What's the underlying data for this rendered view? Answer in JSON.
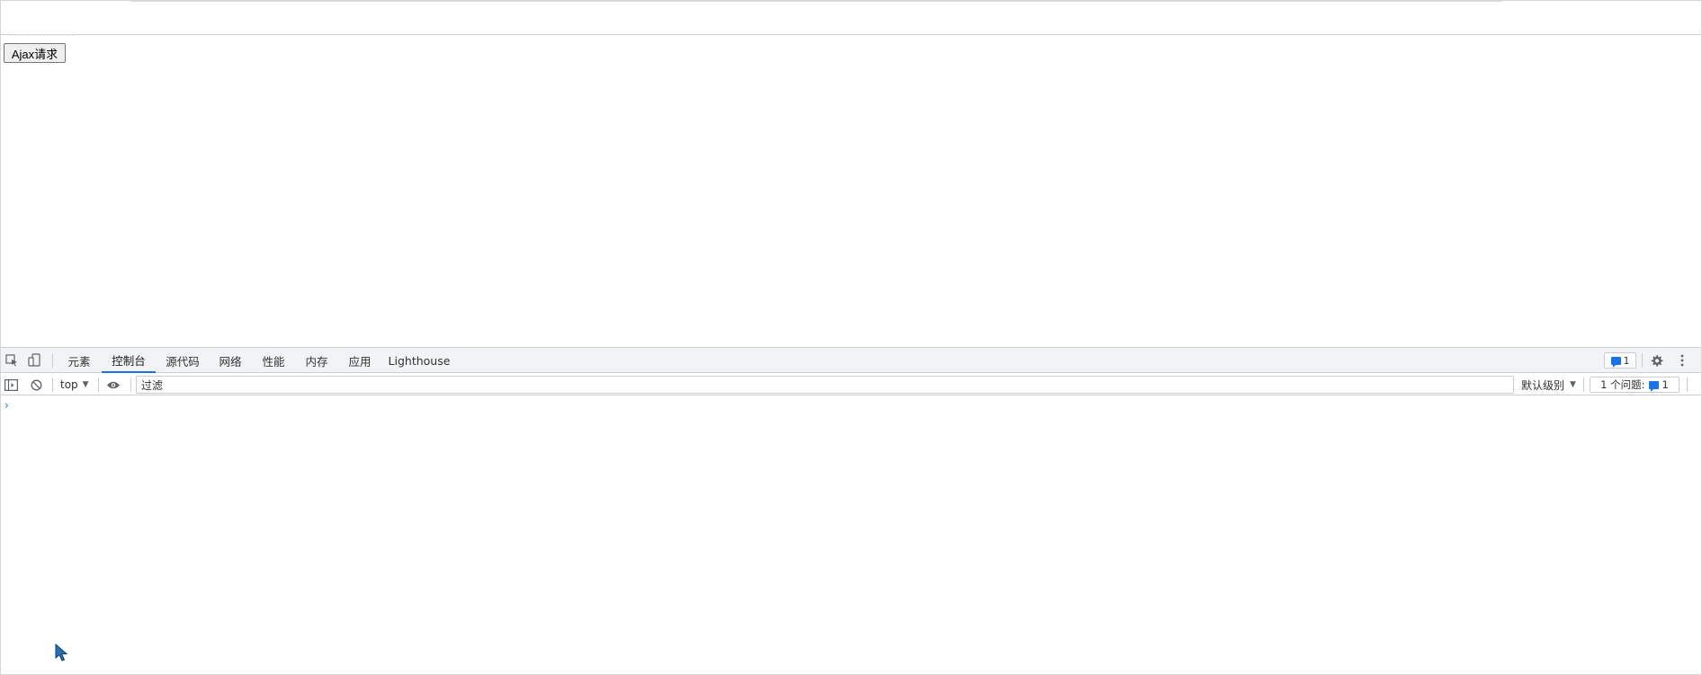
{
  "page": {
    "button_label": "Ajax请求"
  },
  "devtools": {
    "tabs": [
      "元素",
      "控制台",
      "源代码",
      "网络",
      "性能",
      "内存",
      "应用",
      "Lighthouse"
    ],
    "active_tab": "控制台",
    "issues_badge_count": "1",
    "console_toolbar": {
      "context": "top",
      "filter_placeholder": "过滤",
      "level_label": "默认级别",
      "issues_label": "1 个问题:",
      "issues_count": "1"
    },
    "prompt_glyph": "›"
  },
  "colors": {
    "accent": "#1a73e8",
    "toolbar_bg": "#f1f3f4",
    "border": "#cbcdd1"
  }
}
